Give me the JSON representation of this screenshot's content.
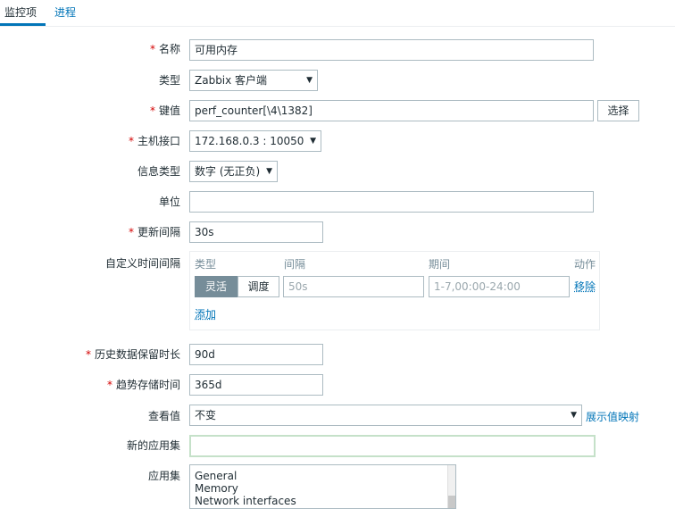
{
  "tabs": {
    "active": "监控项",
    "other": "进程"
  },
  "form": {
    "name": {
      "label": "名称",
      "value": "可用内存"
    },
    "type": {
      "label": "类型",
      "value": "Zabbix 客户端"
    },
    "key": {
      "label": "键值",
      "value": "perf_counter[\\4\\1382]",
      "select_button": "选择"
    },
    "host_interface": {
      "label": "主机接口",
      "value": "172.168.0.3 : 10050"
    },
    "info_type": {
      "label": "信息类型",
      "value": "数字 (无正负)"
    },
    "units": {
      "label": "单位",
      "value": ""
    },
    "update_interval": {
      "label": "更新间隔",
      "value": "30s"
    },
    "custom_intervals": {
      "label": "自定义时间间隔",
      "headers": {
        "type": "类型",
        "interval": "间隔",
        "period": "期间",
        "action": "动作"
      },
      "row": {
        "flexible": "灵活",
        "scheduling": "调度",
        "interval_placeholder": "50s",
        "period_placeholder": "1-7,00:00-24:00",
        "remove": "移除"
      },
      "add": "添加"
    },
    "history": {
      "label": "历史数据保留时长",
      "value": "90d"
    },
    "trends": {
      "label": "趋势存储时间",
      "value": "365d"
    },
    "show_value": {
      "label": "查看值",
      "value": "不变",
      "mapping_link": "展示值映射"
    },
    "new_application": {
      "label": "新的应用集",
      "value": ""
    },
    "applications": {
      "label": "应用集",
      "items": [
        "General",
        "Memory",
        "Network interfaces"
      ]
    }
  }
}
